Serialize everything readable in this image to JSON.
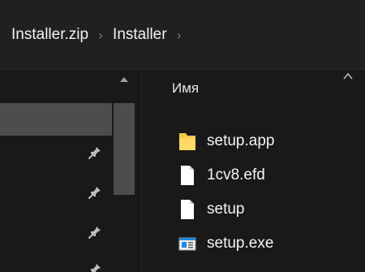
{
  "address_bar": {
    "crumbs": [
      {
        "label": "Installer.zip"
      },
      {
        "label": "Installer"
      }
    ],
    "separator": "›"
  },
  "navigation_pane": {
    "selected_item_present": true,
    "pinned_icons": [
      "pin-icon",
      "pin-icon",
      "pin-icon",
      "pin-icon"
    ]
  },
  "content_pane": {
    "column_header": "Имя",
    "files": [
      {
        "name": "setup.app",
        "icon": "folder-icon"
      },
      {
        "name": "1cv8.efd",
        "icon": "file-icon"
      },
      {
        "name": "setup",
        "icon": "file-icon"
      },
      {
        "name": "setup.exe",
        "icon": "exe-icon"
      }
    ]
  },
  "colors": {
    "background": "#191919",
    "address_bar": "#202020",
    "selection": "#4d4d4d",
    "folder": "#f2c94c",
    "exe_accent": "#1e88e5"
  }
}
